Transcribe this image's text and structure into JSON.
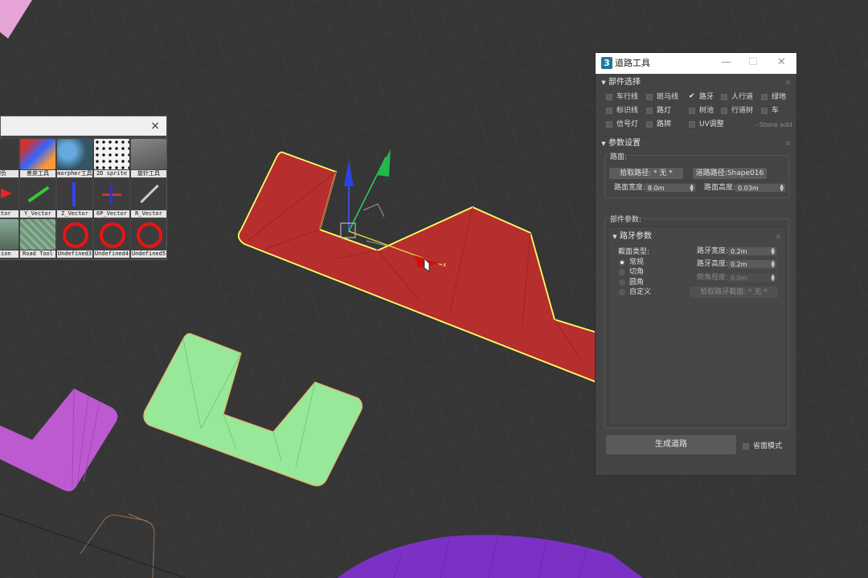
{
  "viewport": {
    "colors": {
      "background": "#363636",
      "grid": "#404040",
      "selected_shape": "#b72e2e",
      "selection_outline": "#ffff66",
      "green_shape": "#98e899",
      "pink_shape": "#ba55d3",
      "purple_shape": "#7b32c4"
    }
  },
  "tool_panel": {
    "close_glyph": "×",
    "row1": [
      "的负",
      "差皮工具",
      "morpher工具",
      "2D sprite",
      "旋针工具"
    ],
    "row2": [
      "Vector",
      "Y_Vector",
      "Z_Vector",
      "6P_Vector",
      "R_Vector"
    ],
    "row3": [
      "Motion",
      "Road Tool",
      "Undefined3",
      "Undefined4",
      "Undefined5"
    ]
  },
  "road_window": {
    "logo": "3",
    "title": "道路工具",
    "min_glyph": "—",
    "max_glyph": "☐",
    "close_glyph": "✕",
    "section_parts": {
      "title": "部件选择",
      "items": [
        {
          "label": "车行线",
          "checked": false
        },
        {
          "label": "斑马线",
          "checked": false
        },
        {
          "label": "路牙",
          "checked": true
        },
        {
          "label": "人行道",
          "checked": false
        },
        {
          "label": "绿地",
          "checked": false
        },
        {
          "label": "标识线",
          "checked": false
        },
        {
          "label": "路灯",
          "checked": false
        },
        {
          "label": "树池",
          "checked": false
        },
        {
          "label": "行道树",
          "checked": false
        },
        {
          "label": "车",
          "checked": false
        },
        {
          "label": "信号灯",
          "checked": false
        },
        {
          "label": "路牌",
          "checked": false
        },
        {
          "label": "UV调整",
          "checked": false
        }
      ],
      "stone_add": "--Stone add"
    },
    "section_params": {
      "title": "参数设置",
      "surface_label": "路面:",
      "pick_path_btn": "拾取路径: * 无 *",
      "road_path_btn": "道路路径:Shape016",
      "width_label": "路面宽度:",
      "width_value": "8.0m",
      "height_label": "路面高度:",
      "height_value": "0.03m",
      "component_params_label": "部件参数:",
      "curb": {
        "title": "路牙参数",
        "section_type_label": "截面类型:",
        "types": [
          {
            "label": "常规",
            "selected": true
          },
          {
            "label": "切角",
            "selected": false
          },
          {
            "label": "圆角",
            "selected": false
          },
          {
            "label": "自定义",
            "selected": false
          }
        ],
        "curb_width_label": "路牙宽度:",
        "curb_width_value": "0.2m",
        "curb_height_label": "路牙高度:",
        "curb_height_value": "0.2m",
        "chamfer_label": "倒角程度:",
        "chamfer_value": "0.0m",
        "pick_section_btn": "拾取路牙截面: * 无 *"
      }
    },
    "generate_btn": "生成道路",
    "save_mode_label": "省面模式"
  }
}
